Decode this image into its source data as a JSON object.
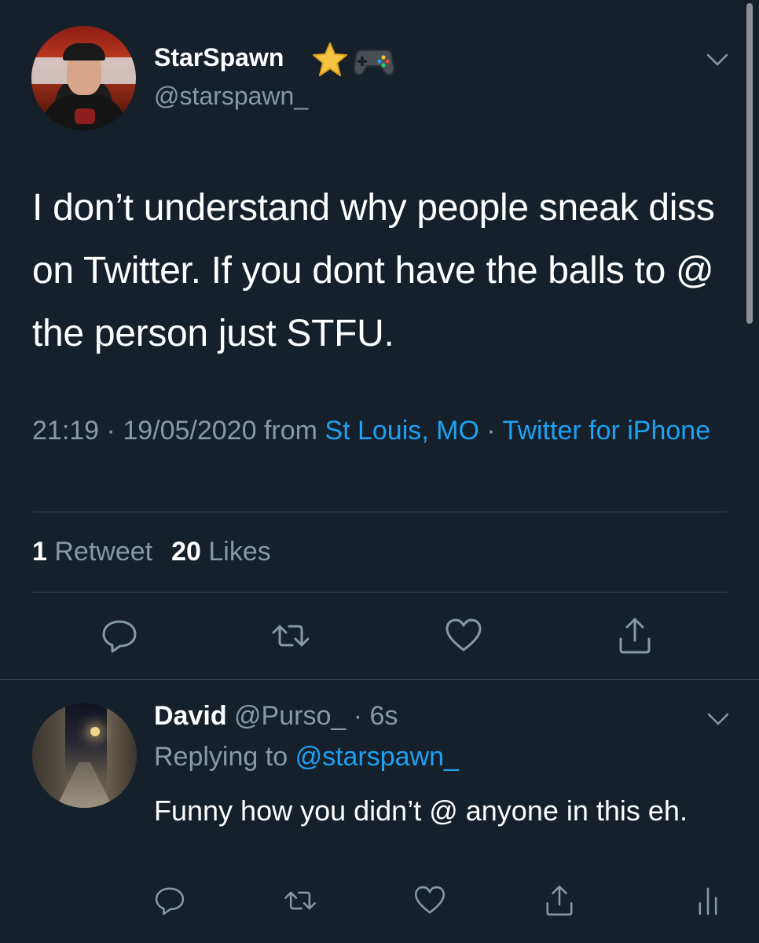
{
  "tweet": {
    "display_name": "StarSpawn",
    "name_emojis": [
      "star-emoji",
      "game-controller-emoji"
    ],
    "handle": "@starspawn_",
    "text": "I don’t understand why people sneak diss on Twitter. If you dont have the balls to @ the person just STFU.",
    "time": "21:19",
    "date": "19/05/2020",
    "from_label": "from",
    "location": "St Louis, MO",
    "client": "Twitter for iPhone",
    "separator": "·",
    "retweets_count": "1",
    "retweets_label": "Retweet",
    "likes_count": "20",
    "likes_label": "Likes",
    "actions": [
      "reply-icon",
      "retweet-icon",
      "like-icon",
      "share-icon"
    ]
  },
  "reply": {
    "display_name": "David",
    "handle": "@Purso_",
    "separator": "·",
    "time_ago": "6s",
    "replying_label": "Replying to",
    "replying_to": "@starspawn_",
    "text": "Funny how you didn’t @ anyone in this eh.",
    "actions": [
      "reply-icon",
      "retweet-icon",
      "like-icon",
      "share-icon",
      "analytics-icon"
    ]
  },
  "colors": {
    "background": "#15202b",
    "text_primary": "#ffffff",
    "text_secondary": "#8899a6",
    "accent": "#1da1f2",
    "divider": "#38444d"
  }
}
